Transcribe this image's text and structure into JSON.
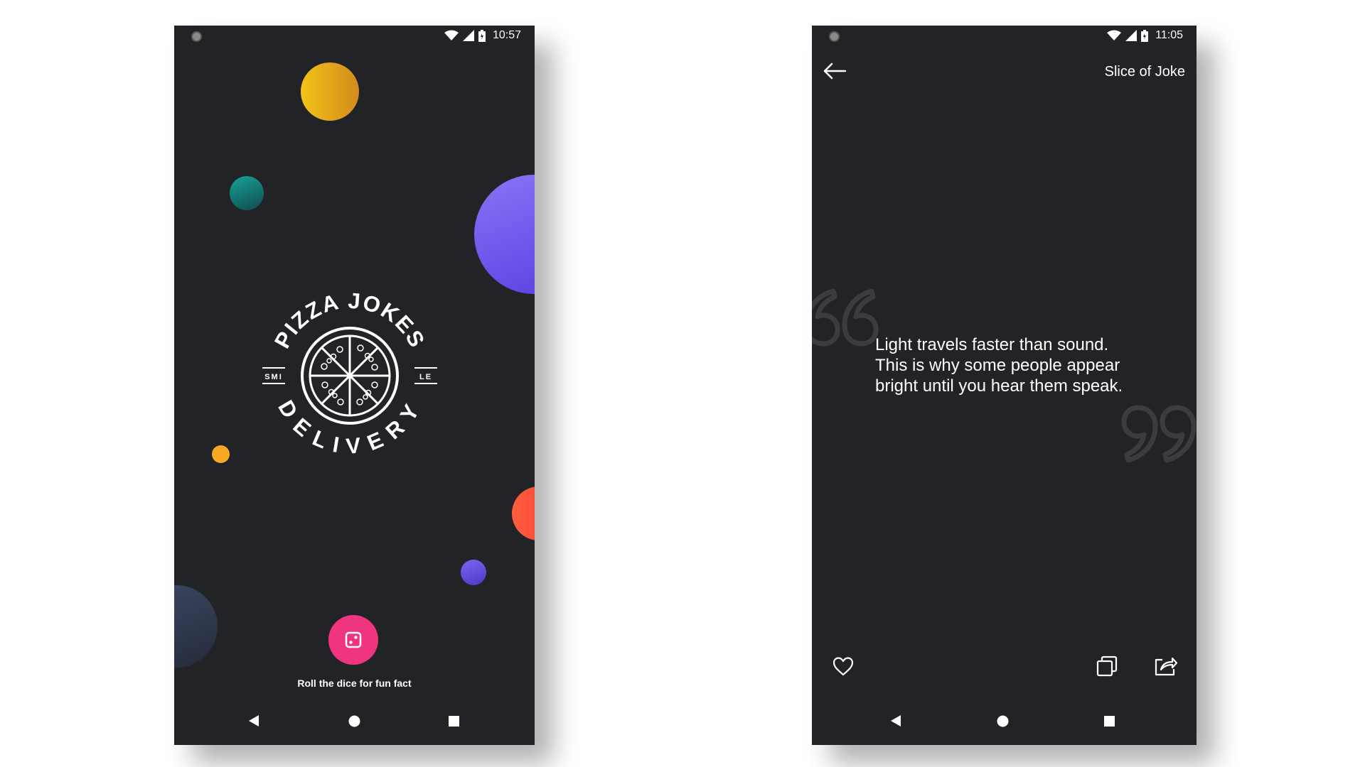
{
  "screen_left": {
    "status_bar": {
      "time": "10:57"
    },
    "logo": {
      "top_text": "PIZZA JOKES",
      "bottom_text": "DELIVERY",
      "left_tag": "SMI",
      "right_tag": "LE"
    },
    "roll_button_icon": "dice-icon",
    "roll_caption": "Roll the dice for fun fact",
    "colors": {
      "background": "#222326",
      "roll_button": "#f0357f",
      "blob_yellow": "#f1c21b",
      "blob_teal": "#15a396",
      "blob_purple": "#7a5cf2",
      "blob_orange": "#f9a826",
      "blob_red": "#ff5f3f",
      "blob_violet": "#6a5ae0",
      "blob_slate": "#34405a"
    }
  },
  "screen_right": {
    "status_bar": {
      "time": "11:05"
    },
    "title": "Slice of Joke",
    "joke": "Light travels faster than sound. This is why some people appear bright until you hear them speak.",
    "actions": [
      "heart-icon",
      "copy-icon",
      "share-icon"
    ]
  },
  "nav_icons": [
    "back-triangle-icon",
    "home-circle-icon",
    "recents-square-icon"
  ]
}
